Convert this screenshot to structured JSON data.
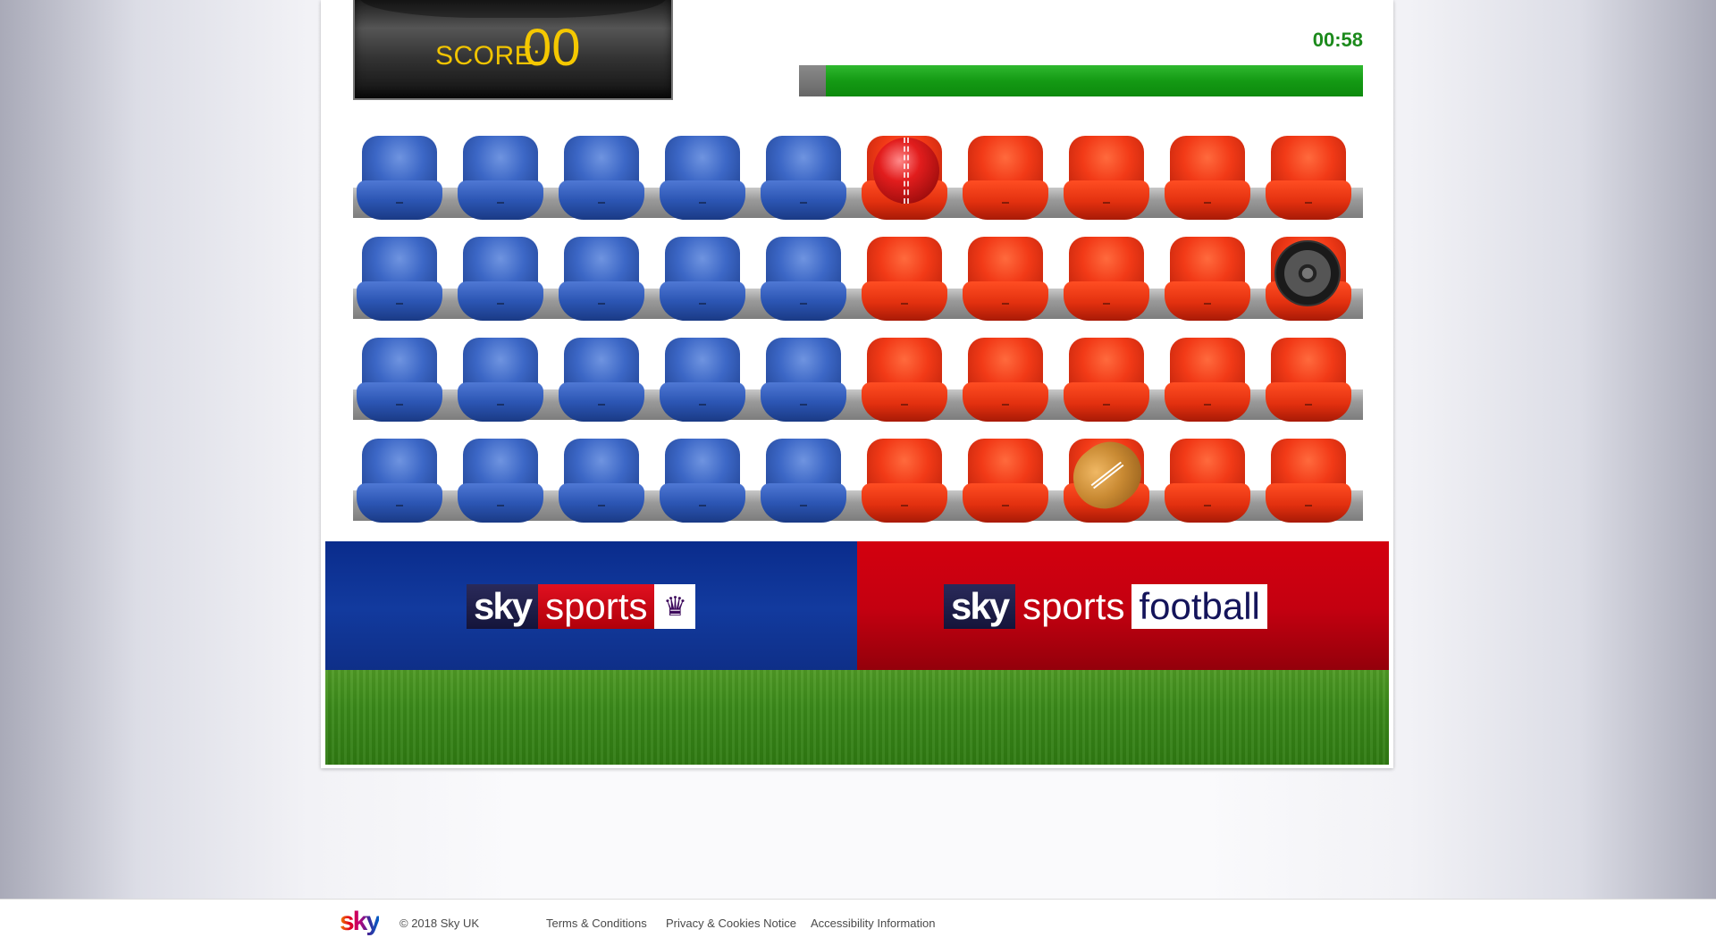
{
  "score": {
    "label": "SCORE:",
    "value": "00"
  },
  "timer": {
    "text": "00:58",
    "remaining_fraction": 0.953
  },
  "stands": {
    "rows": 4,
    "columns": 10,
    "blue_columns": 5,
    "colors": {
      "blue": "#3c67c6",
      "red": "#f23a17"
    },
    "items": [
      {
        "row": 0,
        "col": 5,
        "icon": "cricket-ball"
      },
      {
        "row": 1,
        "col": 9,
        "icon": "tyre"
      },
      {
        "row": 3,
        "col": 7,
        "icon": "rugby-ball"
      }
    ]
  },
  "banners": {
    "left": {
      "sky": "sky",
      "sports": "sports",
      "badge": "♛",
      "color": "#0a2c8c"
    },
    "right": {
      "sky": "sky",
      "sports": "sports",
      "football": "football",
      "color": "#d3000f"
    }
  },
  "footer": {
    "logo": "sky",
    "copyright": "© 2018 Sky UK",
    "links": [
      "Terms & Conditions",
      "Privacy & Cookies Notice",
      "Accessibility Information"
    ]
  }
}
